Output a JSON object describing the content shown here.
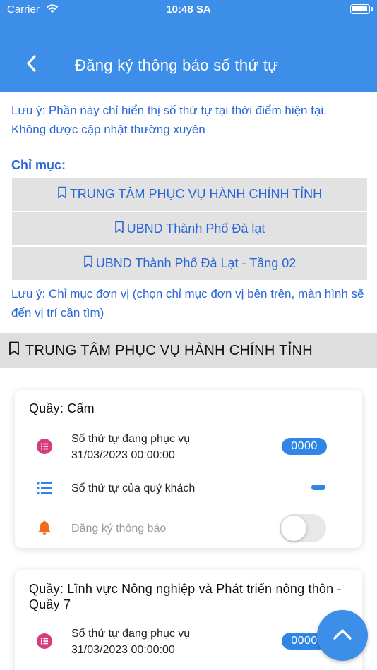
{
  "status_bar": {
    "carrier": "Carrier",
    "time": "10:48 SA",
    "icons": [
      "wifi-icon",
      "battery-icon"
    ]
  },
  "header": {
    "title": "Đăng ký thông báo số thứ tự",
    "back_icon": "chevron-left-icon"
  },
  "notes": {
    "top": "Lưu ý: Phần này chỉ hiển thị số thứ tự tại thời điểm hiện tại. Không được cập nhật thường xuyên",
    "index": "Lưu ý: Chỉ mục đơn vị (chọn chỉ mục đơn vị bên trên, màn hình sẽ đến vị trí cần tìm)"
  },
  "index": {
    "label": "Chỉ mục:",
    "items": [
      {
        "label": "TRUNG TÂM PHỤC VỤ HÀNH CHÍNH TỈNH",
        "icon": "bookmark-icon"
      },
      {
        "label": "UBND Thành Phố Đà lạt",
        "icon": "bookmark-icon"
      },
      {
        "label": "UBND Thành Phố Đà Lạt - Tầng 02",
        "icon": "bookmark-icon"
      }
    ]
  },
  "section": {
    "title": "TRUNG TÂM PHỤC VỤ HÀNH CHÍNH TỈNH",
    "icon": "bookmark-icon"
  },
  "counters": [
    {
      "title": "Quầy: Cấm",
      "serving_label": "Số thứ tự đang phục vụ",
      "serving_time": "31/03/2023 00:00:00",
      "serving_number": "0000",
      "customer_label": "Số thứ tự của quý khách",
      "notify_label": "Đăng ký thông báo",
      "notify_enabled": false
    },
    {
      "title": "Quầy: Lĩnh vực Nông nghiệp và Phát triển nông thôn - Quầy 7",
      "serving_label": "Số thứ tự đang phục vụ",
      "serving_time": "31/03/2023 00:00:00",
      "serving_number": "0000"
    }
  ],
  "colors": {
    "header_bg": "#3d8ee9",
    "link_blue": "#2a66d8",
    "pill_blue": "#2f86e4",
    "serving_icon": "#d63d7e",
    "bell_icon": "#f26b1d",
    "list_icon": "#2f86e4"
  },
  "fab_icon": "chevron-up-icon"
}
